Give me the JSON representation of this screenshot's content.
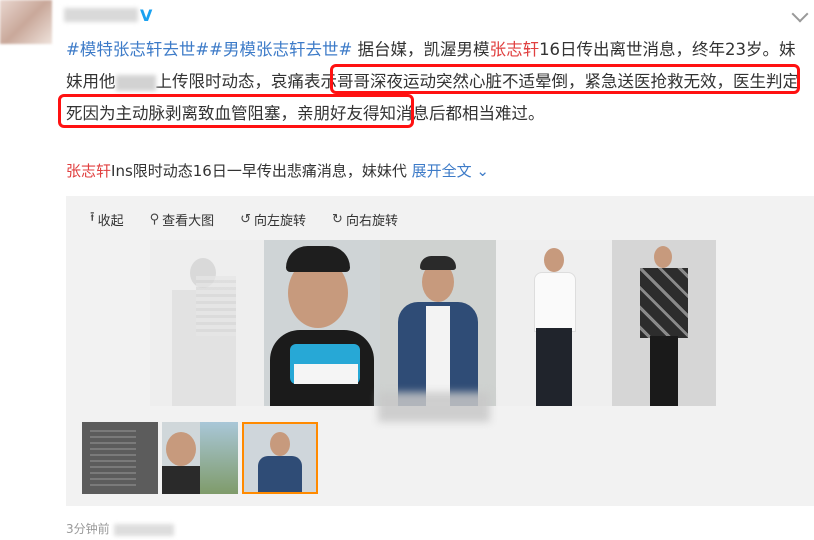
{
  "post": {
    "hashtag1": "#模特张志轩去世#",
    "hashtag2": "#男模张志轩去世#",
    "text_a": " 据台媒，凯渥男模",
    "name1": "张志轩",
    "text_b": "16日传出离世消息，终年23岁。妹妹用他",
    "text_c": "上传限时动态，",
    "text_d": "哀痛表示哥哥深夜运动突然心脏不适晕倒，紧急送医抢救无效，医生判定死因为主动脉剥离致血管阻塞，",
    "text_e": "亲朋好友得知消息后都相当难过。"
  },
  "summary": {
    "name": "张志轩",
    "text": "Ins限时动态16日一早传出悲痛消息，妹妹代",
    "expand_label": "展开全文"
  },
  "viewer": {
    "collapse_label": "收起",
    "view_large_label": "查看大图",
    "rotate_left_label": "向左旋转",
    "rotate_right_label": "向右旋转"
  },
  "footer": {
    "timestamp": "3分钟前"
  },
  "colors": {
    "link": "#3d7bc8",
    "highlight_name": "#e03f3f",
    "annotation_box": "#ff1111",
    "verified": "#1aa1f0"
  },
  "icons": {
    "verified": "verified-badge-icon",
    "collapse": "collapse-arrow-icon",
    "zoom": "magnifier-icon",
    "rotate_left": "rotate-left-icon",
    "rotate_right": "rotate-right-icon",
    "expand": "chevron-down-icon"
  }
}
